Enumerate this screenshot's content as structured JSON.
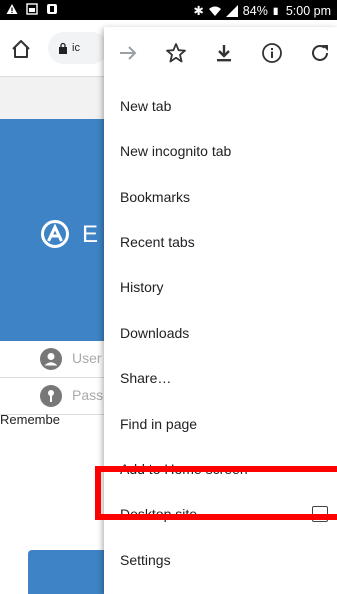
{
  "status_bar": {
    "battery": "84%",
    "time": "5:00 pm"
  },
  "toolbar": {
    "url_text": "ic"
  },
  "page": {
    "hero_text": "E",
    "username_placeholder": "User",
    "password_placeholder": "Pass",
    "remember_text": "Remembe"
  },
  "menu": {
    "items": [
      {
        "label": "New tab"
      },
      {
        "label": "New incognito tab"
      },
      {
        "label": "Bookmarks"
      },
      {
        "label": "Recent tabs"
      },
      {
        "label": "History"
      },
      {
        "label": "Downloads"
      },
      {
        "label": "Share…"
      },
      {
        "label": "Find in page"
      },
      {
        "label": "Add to Home screen"
      },
      {
        "label": "Desktop site"
      },
      {
        "label": "Settings"
      }
    ]
  },
  "colors": {
    "accent": "#3d83c5",
    "highlight": "#ff0000"
  }
}
